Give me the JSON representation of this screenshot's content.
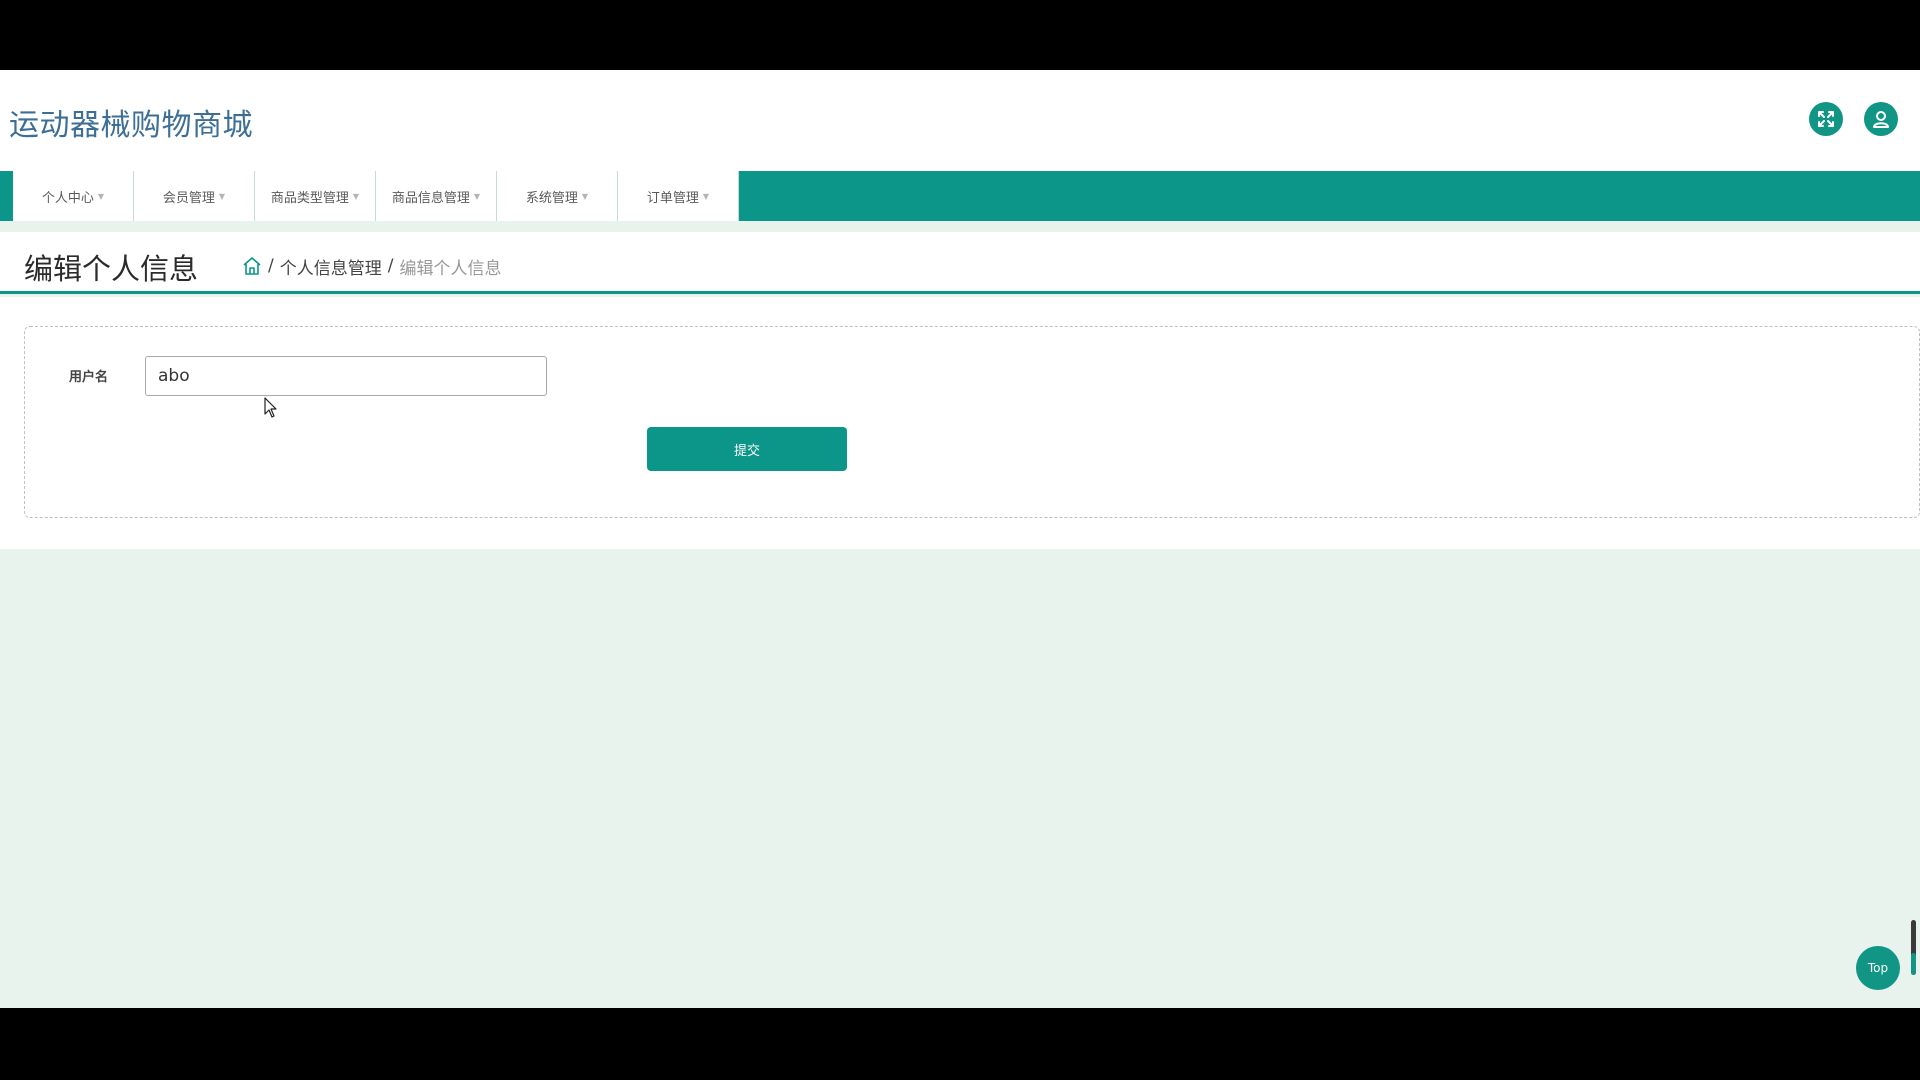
{
  "header": {
    "site_title": "运动器械购物商城",
    "icons": [
      "fullscreen-icon",
      "user-icon"
    ]
  },
  "nav": {
    "items": [
      {
        "label": "个人中心"
      },
      {
        "label": "会员管理"
      },
      {
        "label": "商品类型管理"
      },
      {
        "label": "商品信息管理"
      },
      {
        "label": "系统管理"
      },
      {
        "label": "订单管理"
      }
    ]
  },
  "page": {
    "title": "编辑个人信息",
    "breadcrumb": {
      "home_icon": "home-icon",
      "separator": "/",
      "link": "个人信息管理",
      "current": "编辑个人信息"
    }
  },
  "form": {
    "username_label": "用户名",
    "username_value": "abo",
    "submit_label": "提交"
  },
  "floating": {
    "top_label": "Top"
  },
  "colors": {
    "primary": "#0c968a",
    "title_blue": "#3d6f96",
    "page_bg": "#e8f3ee"
  }
}
